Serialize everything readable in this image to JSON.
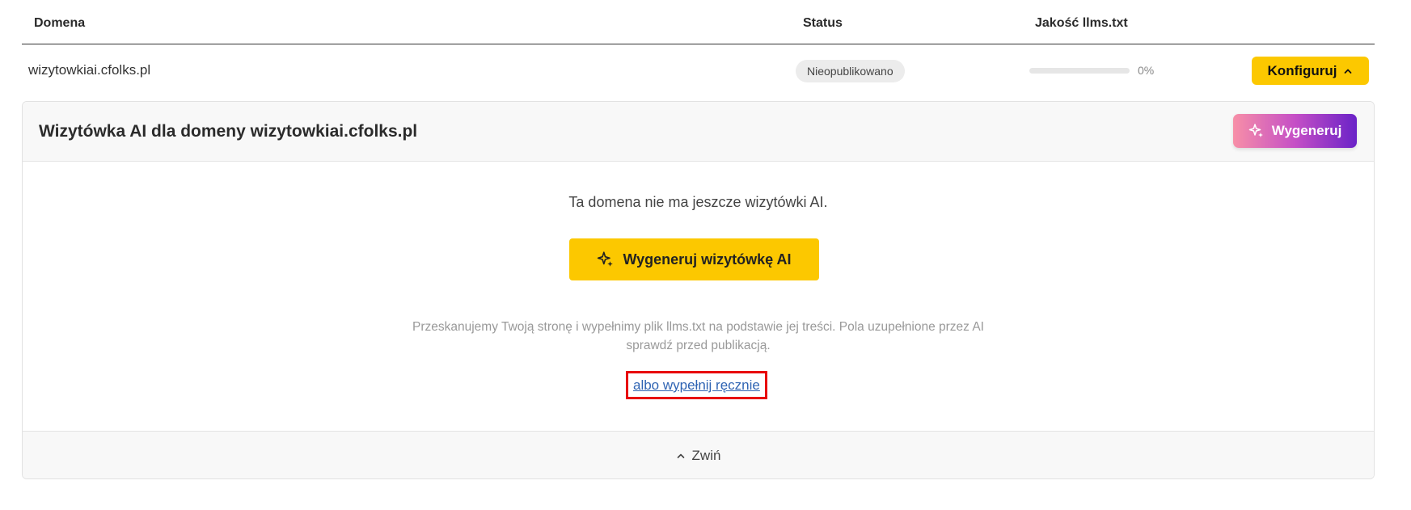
{
  "table": {
    "headers": {
      "domain": "Domena",
      "status": "Status",
      "quality": "Jakość llms.txt"
    },
    "rows": [
      {
        "domain": "wizytowkiai.cfolks.pl",
        "status": "Nieopublikowano",
        "quality_value": 0,
        "quality_text": "0%",
        "action_label": "Konfiguruj"
      }
    ]
  },
  "panel": {
    "title": "Wizytówka AI dla domeny wizytowkiai.cfolks.pl",
    "generate_label": "Wygeneruj",
    "empty_message": "Ta domena nie ma jeszcze wizytówki AI.",
    "generate_card_label": "Wygeneruj wizytówkę AI",
    "help_line1": "Przeskanujemy Twoją stronę i wypełnimy plik llms.txt na podstawie jej treści. Pola uzupełnione przez AI",
    "help_line2": "sprawdź przed publikacją.",
    "manual_link": "albo wypełnij ręcznie",
    "collapse_label": "Zwiń"
  },
  "colors": {
    "accent": "#fcc800",
    "highlight_border": "#e8000c",
    "link": "#2f64b3",
    "gradient_start": "#f78fa7",
    "gradient_end": "#6a22c7"
  },
  "icons": {
    "config_chevron": "chevron-up-icon",
    "sparkle": "sparkle-icon",
    "collapse_chevron": "chevron-up-icon"
  }
}
